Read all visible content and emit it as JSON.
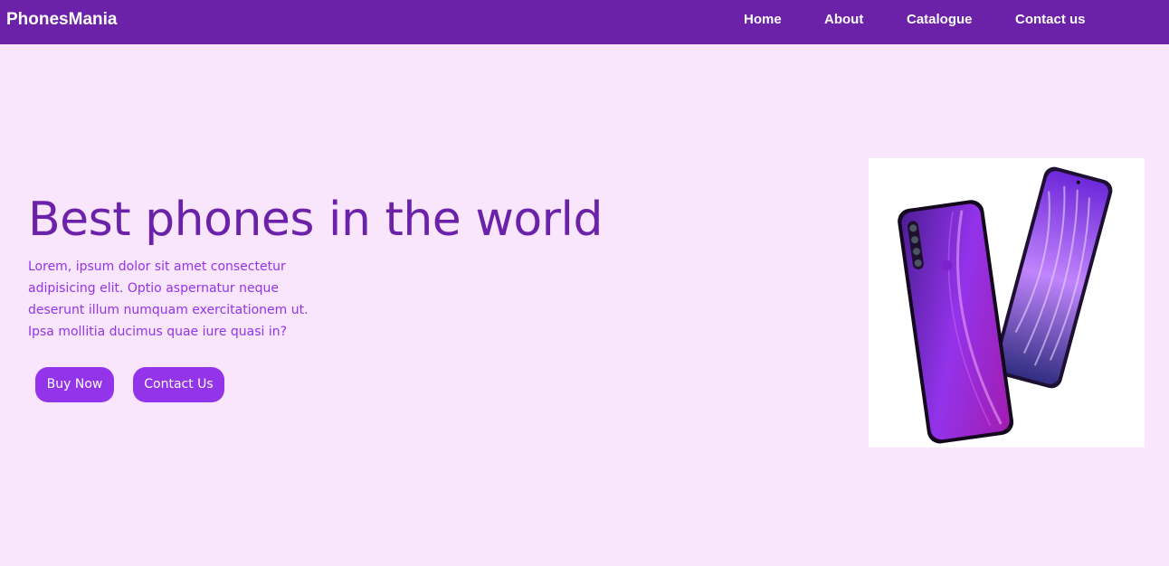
{
  "navbar": {
    "brand": "PhonesMania",
    "links": [
      "Home",
      "About",
      "Catalogue",
      "Contact us"
    ]
  },
  "hero": {
    "title": "Best phones in the world",
    "text": "Lorem, ipsum dolor sit amet consectetur adipisicing elit. Optio aspernatur neque deserunt illum numquam exercitationem ut. Ipsa mollitia ducimus quae iure quasi in?",
    "buttons": {
      "buy": "Buy Now",
      "contact": "Contact Us"
    },
    "image_icon": "smartphones-image"
  },
  "colors": {
    "navbar": "#6b21a8",
    "page_background": "#f9e6fd",
    "title": "#6b21a8",
    "body_text": "#9333ea",
    "button": "#9333ea"
  }
}
